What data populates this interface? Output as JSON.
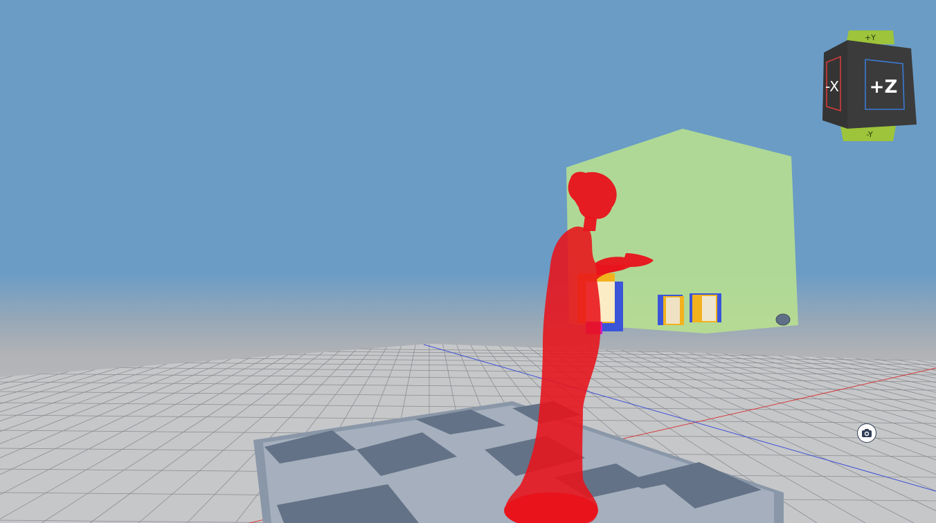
{
  "viewcube": {
    "top_label": "+Y",
    "bottom_label": "-Y",
    "left_label": "-X",
    "front_label": "+Z"
  },
  "toolbar": {
    "camera_icon": "camera-icon"
  },
  "colors": {
    "sky_top": "#6a9cc6",
    "horizon": "#a3a9b0",
    "ground": "#c6c7c9",
    "grid_line": "#7a7c80",
    "axis_x": "#d63a3a",
    "axis_z": "#3a4fd6",
    "statue": "#e8121a",
    "bounding_box": "#b8e08f",
    "cube_face": "#3b3b3b",
    "cube_cap": "#9dc43a",
    "cube_x_frame": "#d43b3b",
    "cube_z_frame": "#3b7bd4"
  }
}
